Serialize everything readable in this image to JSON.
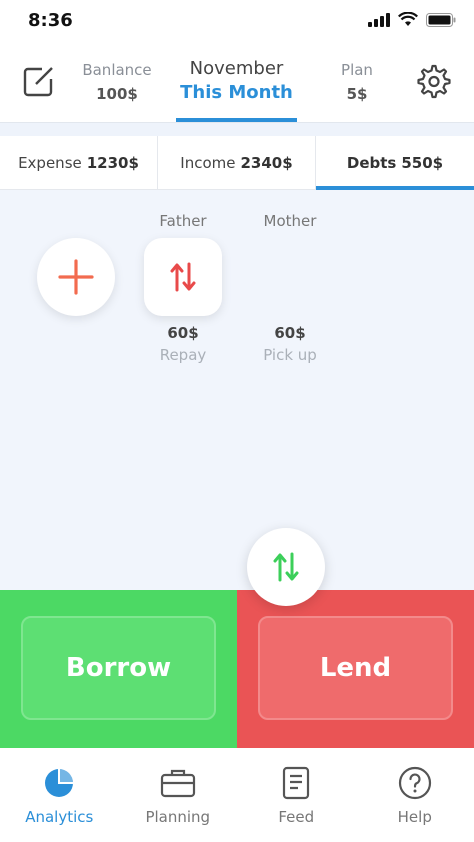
{
  "status_bar": {
    "time": "8:36"
  },
  "header": {
    "balance": {
      "label": "Banlance",
      "value": "100$"
    },
    "month": {
      "label": "November",
      "value": "This Month"
    },
    "plan": {
      "label": "Plan",
      "value": "5$"
    }
  },
  "tabs": [
    {
      "label": "Expense",
      "amount": "1230$",
      "active": false
    },
    {
      "label": "Income",
      "amount": "2340$",
      "active": false
    },
    {
      "label": "Debts",
      "amount": "550$",
      "active": true
    }
  ],
  "people": [
    {
      "name": "Father",
      "amount": "60$",
      "action": "Repay"
    },
    {
      "name": "Mother",
      "amount": "60$",
      "action": "Pick up"
    }
  ],
  "actions": {
    "borrow": "Borrow",
    "lend": "Lend"
  },
  "bottom_nav": [
    {
      "label": "Analytics",
      "icon": "pie-chart-icon",
      "active": true
    },
    {
      "label": "Planning",
      "icon": "briefcase-icon",
      "active": false
    },
    {
      "label": "Feed",
      "icon": "document-icon",
      "active": false
    },
    {
      "label": "Help",
      "icon": "help-icon",
      "active": false
    }
  ],
  "colors": {
    "accent": "#2b8fd8",
    "borrow": "#4cd964",
    "lend": "#ea5455",
    "plus": "#f26b4f",
    "arrow_green": "#3ccf5a",
    "arrow_red": "#e84a4a"
  }
}
